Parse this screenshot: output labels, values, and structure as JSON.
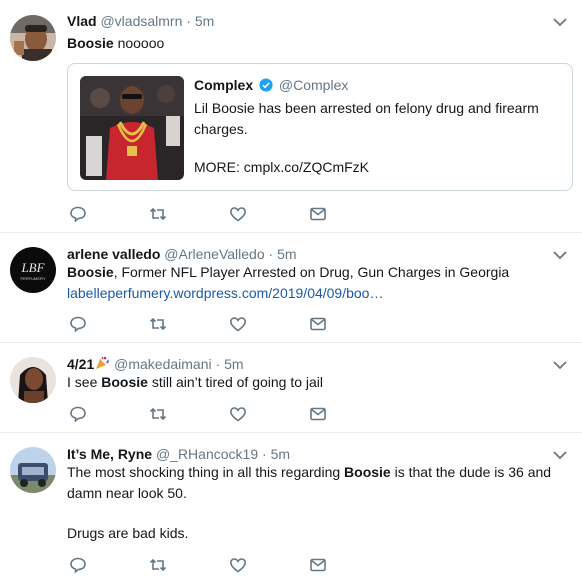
{
  "tweets": [
    {
      "name": "Vlad",
      "handle": "@vladsalmrn",
      "time": "5m",
      "text_bold": "Boosie",
      "text_rest": " nooooo",
      "quote": {
        "name": "Complex",
        "handle": "@Complex",
        "text": "Lil Boosie has been arrested on felony drug and firearm charges.",
        "more_prefix": "MORE: ",
        "more_link": "cmplx.co/ZQCmFzK"
      }
    },
    {
      "name": "arlene valledo",
      "handle": "@ArleneValledo",
      "time": "5m",
      "avatar_text": "PERFUMERY",
      "text_bold": "Boosie",
      "text_rest": ", Former NFL Player Arrested on Drug, Gun Charges in Georgia",
      "link": "labelleperfumery.wordpress.com/2019/04/09/boo…"
    },
    {
      "name": "4/21",
      "handle": "@makedaimani",
      "time": "5m",
      "text_pre": "I see ",
      "text_bold": "Boosie",
      "text_rest": " still ain’t tired of going to jail"
    },
    {
      "name": "It’s Me, Ryne",
      "handle": "@_RHancock19",
      "time": "5m",
      "line1_pre": "The most shocking thing in all this regarding ",
      "text_bold": "Boosie",
      "line1_rest": " is that the dude is 36 and",
      "line2": "damn near look 50.",
      "line3": "Drugs are bad kids."
    }
  ],
  "dot": "·",
  "colors": {
    "name": "#14171a",
    "muted": "#657786",
    "link": "#1b5aa8",
    "border": "#e6ecf0",
    "verified": "#1da1f2"
  },
  "icons": [
    "reply-icon",
    "retweet-icon",
    "like-icon",
    "message-icon",
    "chevron-down-icon",
    "verified-badge-icon",
    "party-popper-icon"
  ]
}
